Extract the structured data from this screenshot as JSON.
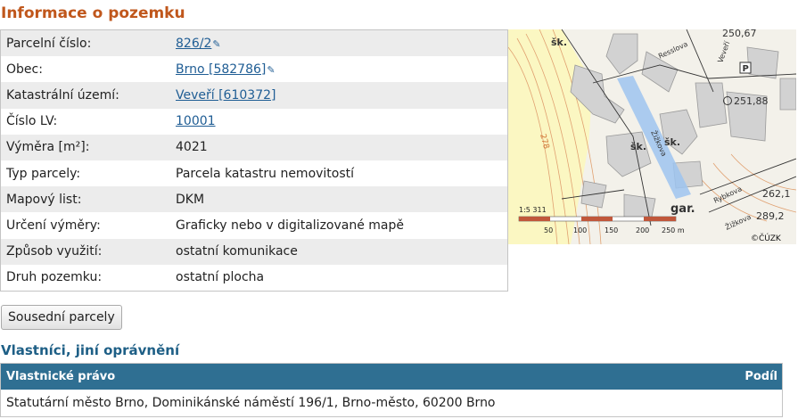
{
  "title": "Informace o pozemku",
  "info_rows": [
    {
      "label": "Parcelní číslo:",
      "value": "826/2",
      "link": true,
      "edit": true
    },
    {
      "label": "Obec:",
      "value": "Brno [582786]",
      "link": true,
      "edit": true
    },
    {
      "label": "Katastrální území:",
      "value": "Veveří [610372]",
      "link": true,
      "edit": false
    },
    {
      "label": "Číslo LV:",
      "value": "10001",
      "link": true,
      "edit": false
    },
    {
      "label": "Výměra [m²]:",
      "value": "4021",
      "link": false,
      "edit": false
    },
    {
      "label": "Typ parcely:",
      "value": "Parcela katastru nemovitostí",
      "link": false,
      "edit": false
    },
    {
      "label": "Mapový list:",
      "value": "DKM",
      "link": false,
      "edit": false
    },
    {
      "label": "Určení výměry:",
      "value": "Graficky nebo v digitalizované mapě",
      "link": false,
      "edit": false
    },
    {
      "label": "Způsob využití:",
      "value": "ostatní komunikace",
      "link": false,
      "edit": false
    },
    {
      "label": "Druh pozemku:",
      "value": "ostatní plocha",
      "link": false,
      "edit": false
    }
  ],
  "map": {
    "labels": [
      "šk.",
      "šk.",
      "šk.",
      "Resslova",
      "Veveří",
      "Žižkova",
      "Rybkova",
      "Žižkova",
      "gar."
    ],
    "heights": [
      "251,88",
      "262,1",
      "289,2",
      "278",
      "250,67"
    ],
    "scale_text": "1:5 311",
    "scale_ticks": [
      "50",
      "100",
      "150",
      "200",
      "250 m"
    ],
    "copyright": "©ČÚZK",
    "parking": "P"
  },
  "neighbor_button": "Sousední parcely",
  "owners": {
    "heading": "Vlastníci, jiní oprávnění",
    "col_right": "Vlastnické právo",
    "col_share": "Podíl",
    "rows": [
      "Statutární město Brno, Dominikánské náměstí 196/1, Brno-město, 60200 Brno"
    ]
  }
}
